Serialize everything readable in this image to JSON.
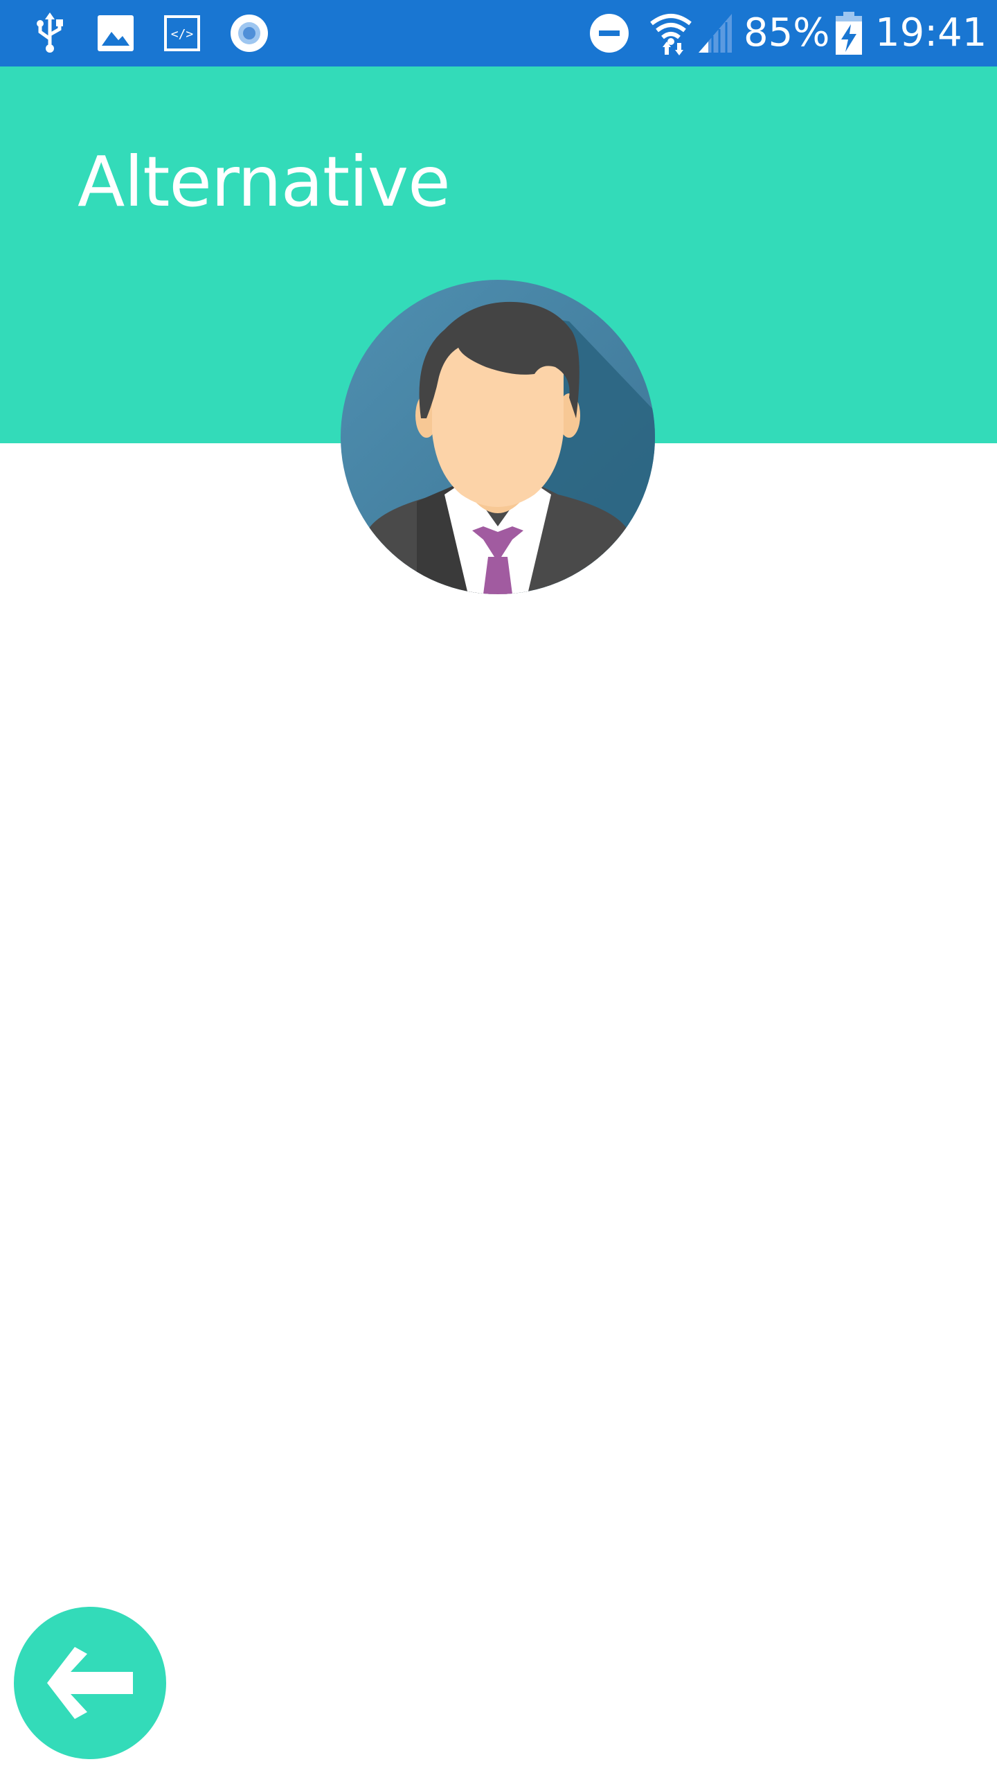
{
  "status_bar": {
    "left_icons": [
      "usb-icon",
      "image-icon",
      "code-icon",
      "record-icon"
    ],
    "right_icons": [
      "do-not-disturb-icon",
      "wifi-icon",
      "cell-signal-icon",
      "battery-charging-icon"
    ],
    "battery_percent": "85%",
    "time": "19:41"
  },
  "header": {
    "title": "Alternative"
  },
  "avatar": {
    "icon": "user-avatar-icon"
  },
  "fab": {
    "icon": "back-arrow-icon"
  },
  "colors": {
    "status_bar": "#1976d2",
    "accent": "#33dbb9",
    "background": "#ffffff"
  }
}
